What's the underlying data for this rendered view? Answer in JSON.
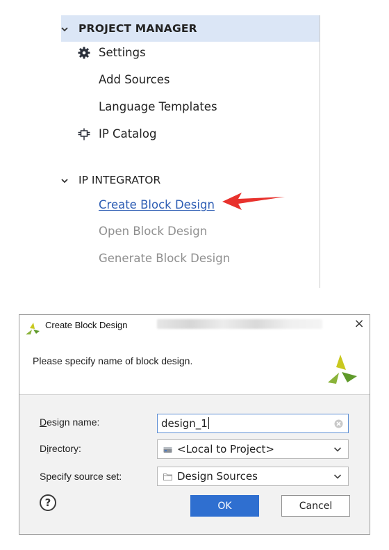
{
  "flow_navigator": {
    "project_manager": {
      "title": "PROJECT MANAGER",
      "items": [
        {
          "label": "Settings",
          "icon": "gear-icon"
        },
        {
          "label": "Add Sources"
        },
        {
          "label": "Language Templates"
        },
        {
          "label": "IP Catalog",
          "icon": "ip-catalog-icon"
        }
      ]
    },
    "ip_integrator": {
      "title": "IP INTEGRATOR",
      "items": [
        {
          "label": "Create Block Design",
          "state": "link"
        },
        {
          "label": "Open Block Design",
          "state": "disabled"
        },
        {
          "label": "Generate Block Design",
          "state": "disabled"
        }
      ]
    },
    "annotation": {
      "type": "arrow",
      "color": "#e8322d"
    }
  },
  "dialog": {
    "title": "Create Block Design",
    "close_glyph": "×",
    "description": "Please specify name of block design.",
    "design_name": {
      "label_mnemonic": "D",
      "label_rest": "esign name:",
      "value": "design_1"
    },
    "directory": {
      "label_pre": "D",
      "label_mnemonic": "i",
      "label_rest": "rectory:",
      "value": "<Local to Project>"
    },
    "source_set": {
      "label": "Specify source set:",
      "value": "Design Sources"
    },
    "help_glyph": "?",
    "ok_label": "OK",
    "cancel_label": "Cancel"
  },
  "colors": {
    "selection": "#dbe6f6",
    "link": "#2e5eb4",
    "disabled": "#8f8f8f",
    "ok_button": "#2f6fd0",
    "focus_border": "#5e8fd4",
    "logo_yellow": "#c9c81f",
    "logo_green": "#5f9a2b"
  }
}
